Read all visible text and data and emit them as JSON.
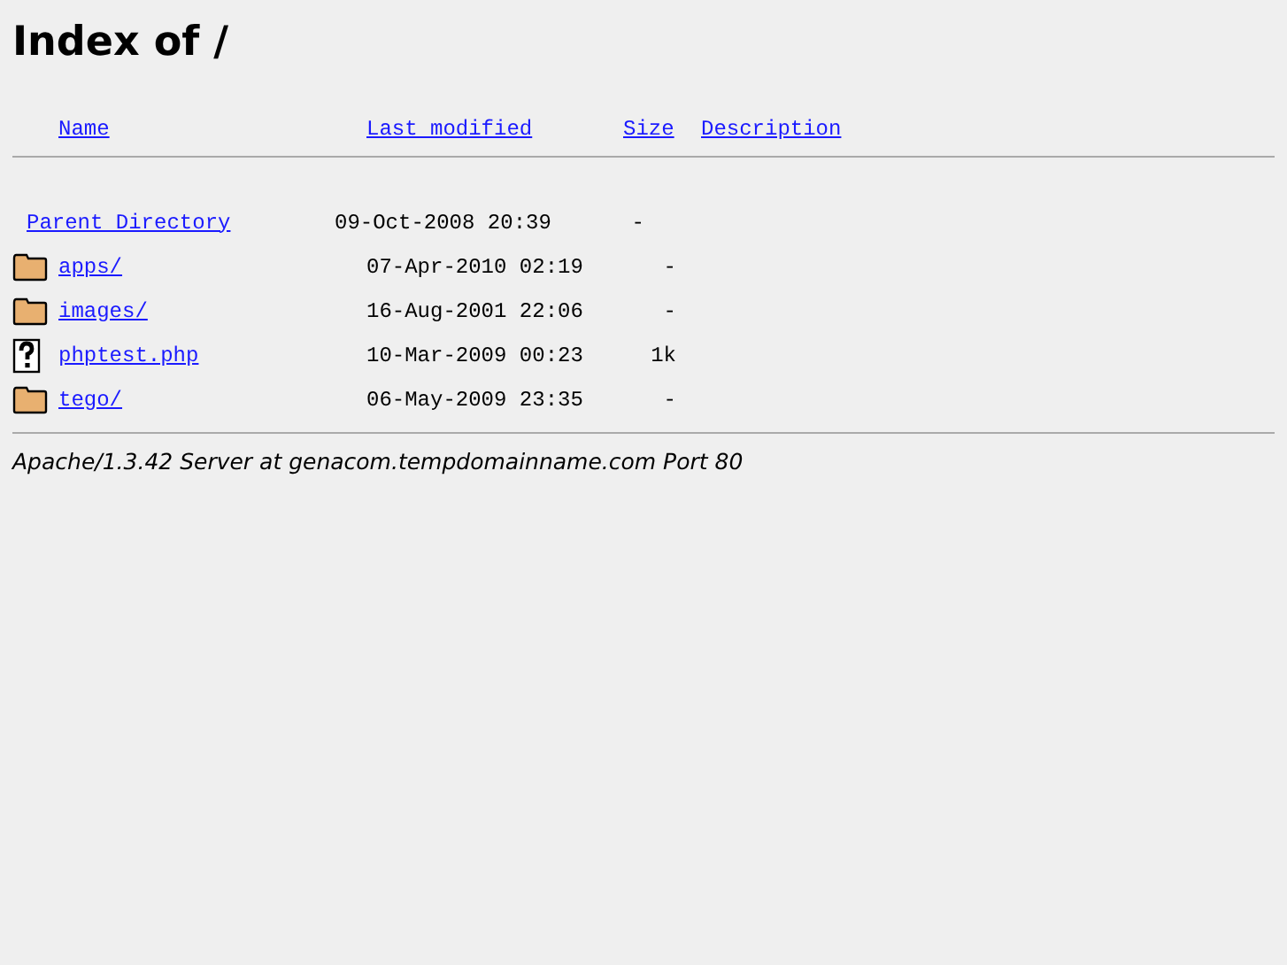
{
  "title": "Index of /",
  "columns": [
    {
      "label": "Name"
    },
    {
      "label": "Last modified"
    },
    {
      "label": "Size"
    },
    {
      "label": "Description"
    }
  ],
  "rows": [
    {
      "kind": "parent",
      "name": "Parent Directory",
      "modified": "09-Oct-2008 20:39",
      "size": "-"
    },
    {
      "kind": "folder",
      "name": "apps/",
      "modified": "07-Apr-2010 02:19",
      "size": "-"
    },
    {
      "kind": "folder",
      "name": "images/",
      "modified": "16-Aug-2001 22:06",
      "size": "-"
    },
    {
      "kind": "file",
      "name": "phptest.php",
      "modified": "10-Mar-2009 00:23",
      "size": "1k"
    },
    {
      "kind": "folder",
      "name": "tego/",
      "modified": "06-May-2009 23:35",
      "size": "-"
    }
  ],
  "footer": "Apache/1.3.42 Server at genacom.tempdomainname.com Port 80"
}
